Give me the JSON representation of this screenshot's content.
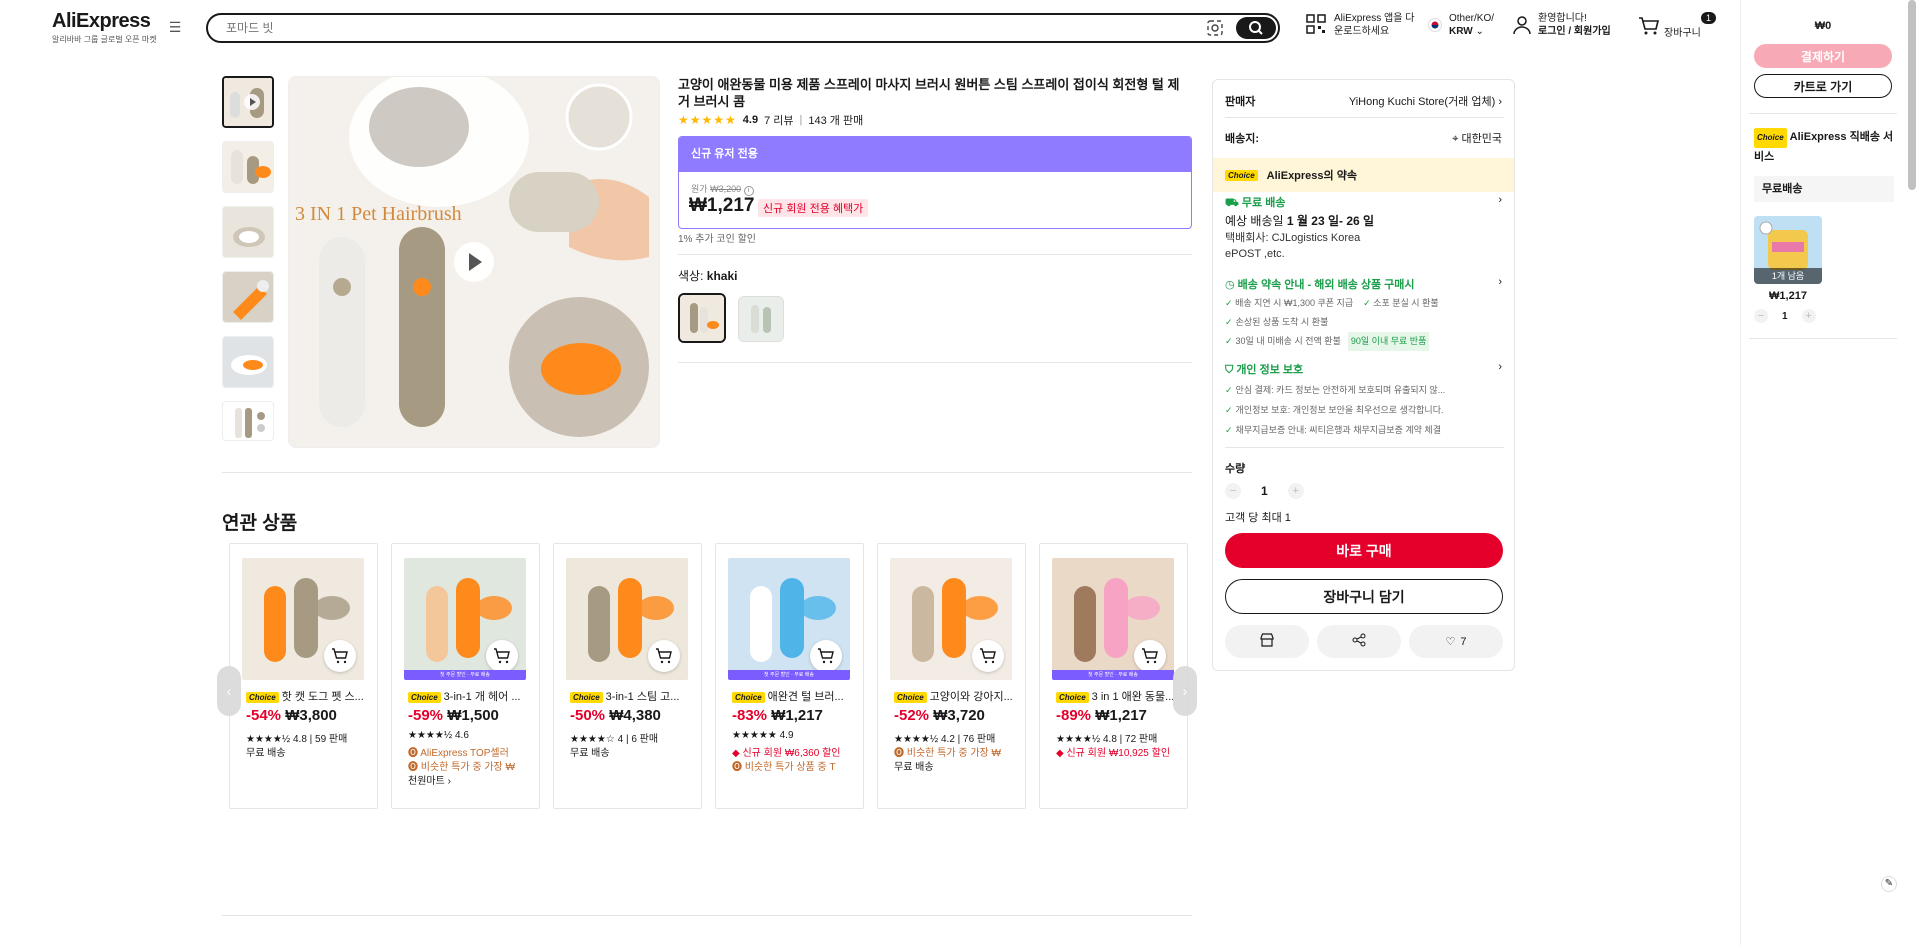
{
  "header": {
    "logo": "AliExpress",
    "logo_sub": "알리바바 그룹 글로벌 오픈 마켓",
    "search_placeholder": "포마드 빗",
    "app_download": [
      "AliExpress 앱을 다",
      "운로드하세요"
    ],
    "locale": [
      "Other/KO/",
      "KRW"
    ],
    "account": [
      "환영합니다!",
      "로그인 / 회원가입"
    ],
    "cart_count": "1",
    "cart_label": "장바구니"
  },
  "gallery": {
    "main_image_text": "3 IN 1 Pet Hairbrush",
    "thumb_count": 6
  },
  "product": {
    "title": "고양이 애완동물 미용 제품 스프레이 마사지 브러시 원버튼 스팀 스프레이 접이식 회전형 털 제거 브러시 콤",
    "rating": "4.9",
    "reviews": "7 리뷰",
    "sold": "143 개 판매",
    "promo_header": "신규 유저 전용",
    "orig_label": "원가",
    "orig_price": "₩3,200",
    "price": "₩1,217",
    "promo_tag": "신규 회원 전용 혜택가",
    "coin_note": "1% 추가 코인 할인",
    "color_label": "색상:",
    "color_value": "khaki"
  },
  "related": {
    "title": "연관 상품",
    "items": [
      {
        "badge": "Choice",
        "name": "핫 캣 도그 펫 스...",
        "off": "-54%",
        "price": "₩3,800",
        "lines": [
          {
            "text": "★★★★½ 4.8 | 59 판매",
            "cls": ""
          },
          {
            "text": "무료 배송",
            "cls": ""
          }
        ],
        "band": ""
      },
      {
        "badge": "Choice",
        "name": "3-in-1 개 헤어 ...",
        "off": "-59%",
        "price": "₩1,500",
        "lines": [
          {
            "text": "★★★★½ 4.6",
            "cls": ""
          },
          {
            "text": "🅞 AliExpress TOP셀러",
            "cls": "brown"
          },
          {
            "text": "🅞 비슷한 특가 중 가장 ₩",
            "cls": "brown"
          },
          {
            "text": "천원마트 ›",
            "cls": ""
          }
        ],
        "band": "첫 주문 할인 · 무료 배송"
      },
      {
        "badge": "Choice",
        "name": "3-in-1 스팀 고...",
        "off": "-50%",
        "price": "₩4,380",
        "lines": [
          {
            "text": "★★★★☆ 4 | 6 판매",
            "cls": ""
          },
          {
            "text": "무료 배송",
            "cls": ""
          }
        ],
        "band": ""
      },
      {
        "badge": "Choice",
        "name": "애완견 털 브러...",
        "off": "-83%",
        "price": "₩1,217",
        "lines": [
          {
            "text": "★★★★★ 4.9",
            "cls": ""
          },
          {
            "text": "◆ 신규 회원 ₩6,360 할인",
            "cls": "red"
          },
          {
            "text": "🅞 비슷한 특가 상품 중 T",
            "cls": "brown"
          }
        ],
        "band": "첫 주문 할인 · 무료 배송"
      },
      {
        "badge": "Choice",
        "name": "고양이와 강아지...",
        "off": "-52%",
        "price": "₩3,720",
        "lines": [
          {
            "text": "★★★★½ 4.2 | 76 판매",
            "cls": ""
          },
          {
            "text": "🅞 비슷한 특가 중 가장 ₩",
            "cls": "brown"
          },
          {
            "text": "무료 배송",
            "cls": ""
          }
        ],
        "band": ""
      },
      {
        "badge": "Choice",
        "name": "3 in 1 애완 동물...",
        "off": "-89%",
        "price": "₩1,217",
        "lines": [
          {
            "text": "★★★★½ 4.8 | 72 판매",
            "cls": ""
          },
          {
            "text": "◆ 신규 회원 ₩10,925 할인",
            "cls": "red"
          }
        ],
        "band": "첫 주문 할인 · 무료 배송"
      }
    ]
  },
  "panel": {
    "seller_label": "판매자",
    "seller_value": "YiHong Kuchi Store(거래 업체)",
    "ship_to_label": "배송지:",
    "ship_to_value": "대한민국",
    "choice_badge": "Choice",
    "choice_title": "AliExpress의 약속",
    "free_shipping": "무료 배송",
    "delivery_prefix": "예상 배송일",
    "delivery_dates": "1 월 23 일- 26 일",
    "carrier_line1": "택배회사:  CJLogistics     Korea",
    "carrier_line2": "ePOST ,etc.",
    "promise_title": "배송 약속 안내 - 해외 배송 상품 구매시",
    "promise_items": [
      "배송 지연 시 ₩1,300 쿠폰 지급",
      "소포 분실 시 환불",
      "손상된 상품 도착 시 환불",
      "30일 내 미배송 시 전액 환불"
    ],
    "promise_tag": "90일 이내 무료 반품",
    "privacy_title": "개인 정보 보호",
    "privacy_items": [
      "안심 결제: 카드 정보는 안전하게 보호되며 유출되지 않...",
      "개인정보 보호: 개인정보 보안을 최우선으로 생각합니다.",
      "채무지급보증 안내: 씨티은행과 채무지급보증 계약 체결"
    ],
    "qty_label": "수량",
    "qty_value": "1",
    "qty_limit": "고객 당 최대 1",
    "buy_now": "바로 구매",
    "add_to_cart": "장바구니 담기",
    "wish_count": "7"
  },
  "mini_cart": {
    "total": "₩0",
    "checkout": "결제하기",
    "go_cart": "카트로 가기",
    "choice_badge": "Choice",
    "service_title": "AliExpress 직배송 서비스",
    "free_ship": "무료배송",
    "item_left": "1개 남음",
    "item_price": "₩1,217",
    "item_qty": "1"
  },
  "colors": {
    "accent_red": "#e4002b",
    "promo_purple": "#8e7bff",
    "choice_yellow": "#ffd900",
    "green": "#1a9e4a"
  }
}
